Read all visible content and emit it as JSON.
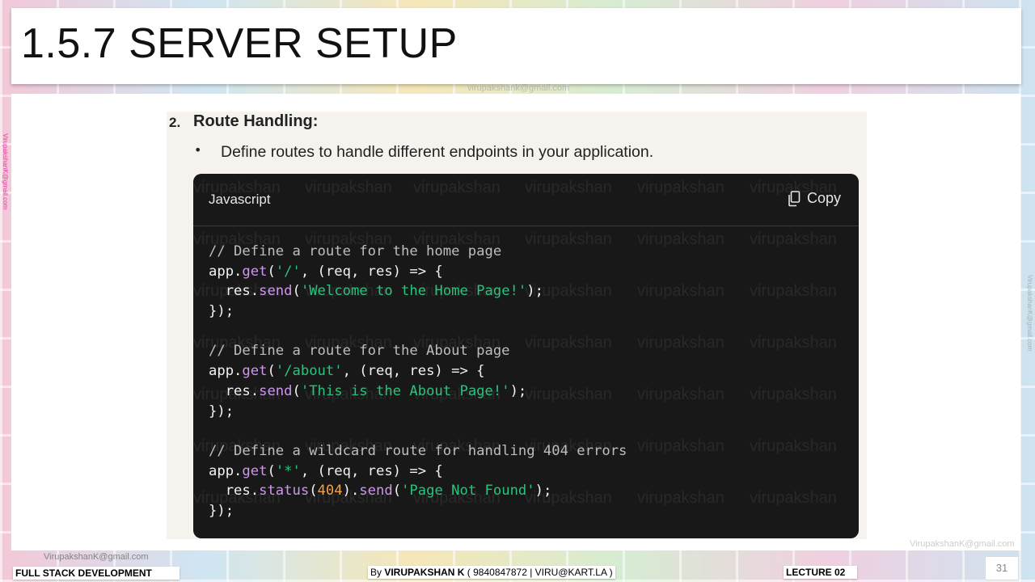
{
  "slide": {
    "title": "1.5.7 SERVER SETUP",
    "watermark_email": "virupakshank@gmail.com",
    "side_email": "VirupakshanK@gmail.com"
  },
  "content": {
    "section_number": "2.",
    "section_heading": "Route Handling:",
    "bullet_symbol": "•",
    "bullet_text": "Define routes to handle different endpoints in your application."
  },
  "code_block": {
    "language": "Javascript",
    "copy_label": "Copy",
    "watermark_text": "virupakshan",
    "colors": {
      "background": "#181818",
      "comment": "#bdbdbd",
      "function": "#cf95f0",
      "string": "#28c37c",
      "number": "#f0a04a"
    },
    "lines": [
      [
        {
          "t": "// Define a route for the home page",
          "c": "comment"
        }
      ],
      [
        {
          "t": "app.",
          "c": "plain"
        },
        {
          "t": "get",
          "c": "fn"
        },
        {
          "t": "(",
          "c": "plain"
        },
        {
          "t": "'/'",
          "c": "str"
        },
        {
          "t": ", (req, res) => {",
          "c": "plain"
        }
      ],
      [
        {
          "t": "  res.",
          "c": "plain"
        },
        {
          "t": "send",
          "c": "fn"
        },
        {
          "t": "(",
          "c": "plain"
        },
        {
          "t": "'Welcome to the Home Page!'",
          "c": "str"
        },
        {
          "t": ");",
          "c": "plain"
        }
      ],
      [
        {
          "t": "});",
          "c": "plain"
        }
      ],
      [],
      [
        {
          "t": "// Define a route for the About page",
          "c": "comment"
        }
      ],
      [
        {
          "t": "app.",
          "c": "plain"
        },
        {
          "t": "get",
          "c": "fn"
        },
        {
          "t": "(",
          "c": "plain"
        },
        {
          "t": "'/about'",
          "c": "str"
        },
        {
          "t": ", (req, res) => {",
          "c": "plain"
        }
      ],
      [
        {
          "t": "  res.",
          "c": "plain"
        },
        {
          "t": "send",
          "c": "fn"
        },
        {
          "t": "(",
          "c": "plain"
        },
        {
          "t": "'This is the About Page!'",
          "c": "str"
        },
        {
          "t": ");",
          "c": "plain"
        }
      ],
      [
        {
          "t": "});",
          "c": "plain"
        }
      ],
      [],
      [
        {
          "t": "// Define a wildcard route for handling 404 errors",
          "c": "comment"
        }
      ],
      [
        {
          "t": "app.",
          "c": "plain"
        },
        {
          "t": "get",
          "c": "fn"
        },
        {
          "t": "(",
          "c": "plain"
        },
        {
          "t": "'*'",
          "c": "str"
        },
        {
          "t": ", (req, res) => {",
          "c": "plain"
        }
      ],
      [
        {
          "t": "  res.",
          "c": "plain"
        },
        {
          "t": "status",
          "c": "fn"
        },
        {
          "t": "(",
          "c": "plain"
        },
        {
          "t": "404",
          "c": "num"
        },
        {
          "t": ").",
          "c": "plain"
        },
        {
          "t": "send",
          "c": "fn"
        },
        {
          "t": "(",
          "c": "plain"
        },
        {
          "t": "'Page Not Found'",
          "c": "str"
        },
        {
          "t": ");",
          "c": "plain"
        }
      ],
      [
        {
          "t": "});",
          "c": "plain"
        }
      ]
    ]
  },
  "footer": {
    "course": "FULL STACK DEVELOPMENT",
    "author_prefix": "By ",
    "author_name": "VIRUPAKSHAN K",
    "author_contact": " ( 9840847872 | VIRU@KART.LA )",
    "lecture": "LECTURE 02",
    "page_number": "31",
    "watermark_left": "VirupakshanK@gmail.com",
    "watermark_right": "VirupakshanK@gmail.com"
  }
}
